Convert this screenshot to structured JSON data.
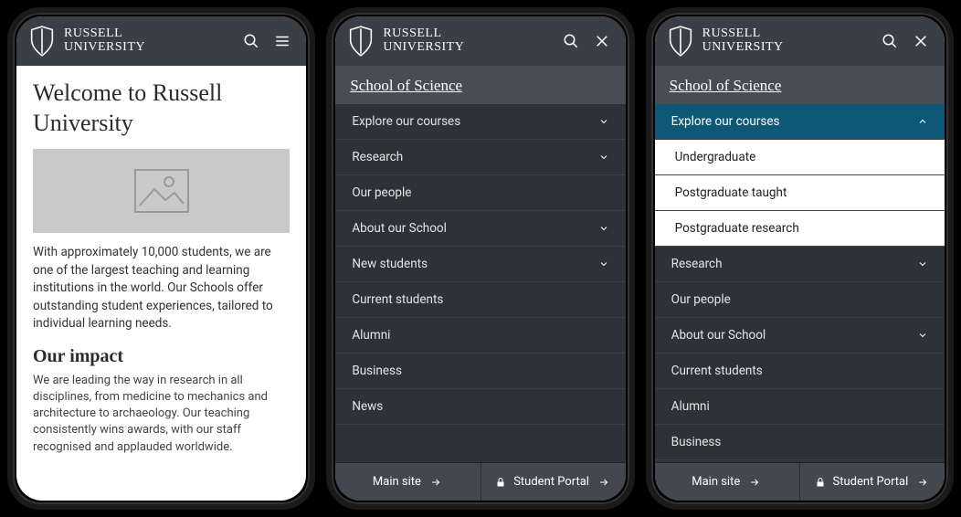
{
  "brand": {
    "line1": "RUSSELL",
    "line2": "UNIVERSITY"
  },
  "screen1": {
    "heading": "Welcome to Russell University",
    "para1": "With approximately 10,000 students, we are one of the largest teaching and learning institutions in the world. Our Schools offer outstanding student experiences, tailored to individual learning needs.",
    "h2": "Our impact",
    "para2": "We are leading the way in research in all disciplines, from medicine to mechanics and architecture to archaeology. Our teaching consistently wins awards, with our staff recognised and applauded worldwide."
  },
  "section_link": "School of Science",
  "menu": {
    "items": [
      {
        "label": "Explore our courses",
        "expandable": true
      },
      {
        "label": "Research",
        "expandable": true
      },
      {
        "label": "Our people",
        "expandable": false
      },
      {
        "label": "About our School",
        "expandable": true
      },
      {
        "label": "New students",
        "expandable": true
      },
      {
        "label": "Current students",
        "expandable": false
      },
      {
        "label": "Alumni",
        "expandable": false
      },
      {
        "label": "Business",
        "expandable": false
      },
      {
        "label": "News",
        "expandable": false
      }
    ],
    "submenu_courses": [
      "Undergraduate",
      "Postgraduate taught",
      "Postgraduate research"
    ]
  },
  "bottom": {
    "main_site": "Main site",
    "student_portal": "Student Portal"
  }
}
